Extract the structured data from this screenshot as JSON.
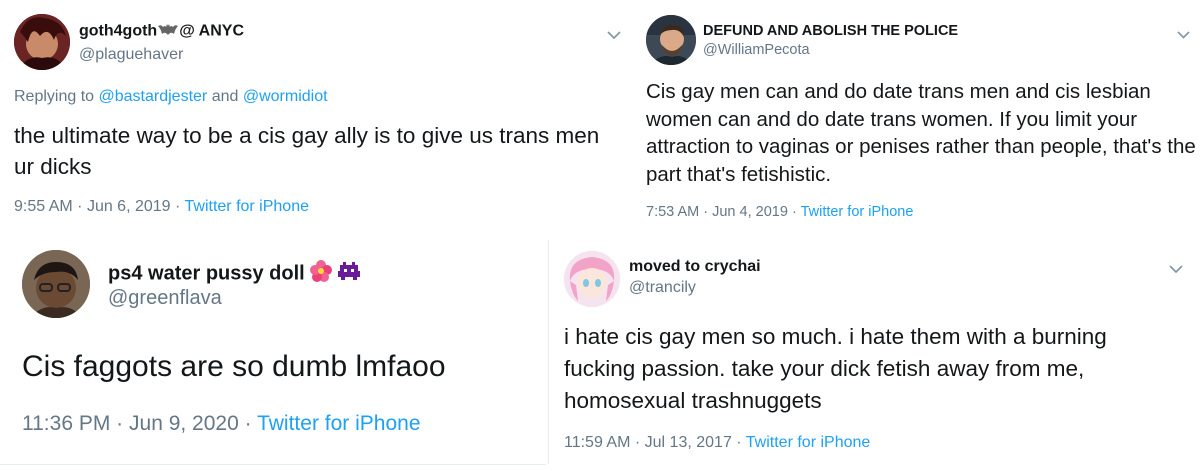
{
  "tweets": [
    {
      "display_name": "goth4goth",
      "name_suffix": "@ ANYC",
      "handle": "@plaguehaver",
      "replying_prefix": "Replying to",
      "replying_user1": "@bastardjester",
      "replying_and": "and",
      "replying_user2": "@wormidiot",
      "text": "the ultimate way to be a cis gay ally is to give us trans men ur dicks",
      "time": "9:55 AM",
      "date": "Jun 6, 2019",
      "source": "Twitter for iPhone",
      "sep": "·"
    },
    {
      "display_name": "DEFUND AND ABOLISH THE POLICE",
      "handle": "@WilliamPecota",
      "text": "Cis gay men can and do date trans men and cis lesbian women can and do date trans women. If you limit your attraction to vaginas or penises rather than people, that's the part that's fetishistic.",
      "time": "7:53 AM",
      "date": "Jun 4, 2019",
      "source": "Twitter for iPhone",
      "sep": "·"
    },
    {
      "display_name": "ps4 water pussy doll",
      "handle": "@greenflava",
      "text": "Cis faggots are so dumb lmfaoo",
      "time": "11:36 PM",
      "date": "Jun 9, 2020",
      "source": "Twitter for iPhone",
      "sep": "·"
    },
    {
      "display_name": "moved to crychai",
      "handle": "@trancily",
      "text": "i hate cis gay men so much. i hate them with a burning fucking passion. take your dick fetish away from me, homosexual trashnuggets",
      "time": "11:59 AM",
      "date": "Jul 13, 2017",
      "source": "Twitter for iPhone",
      "sep": "·"
    }
  ],
  "icons": {
    "chevron": "chevron-down-icon",
    "bat": "bat-emoji-icon",
    "flower": "hibiscus-emoji-icon",
    "invader": "space-invader-emoji-icon"
  },
  "colors": {
    "text": "#14171a",
    "secondary": "#657786",
    "link": "#1da1f2",
    "divider": "#e6ecf0"
  }
}
